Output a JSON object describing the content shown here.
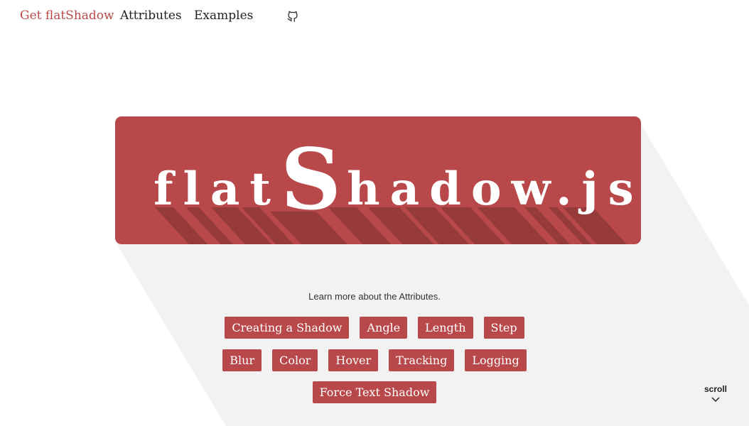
{
  "nav": {
    "items": [
      {
        "label": "Get flatShadow",
        "active": true
      },
      {
        "label": "Attributes",
        "active": false
      },
      {
        "label": "Examples",
        "active": false
      }
    ],
    "github_icon": "github-icon"
  },
  "hero": {
    "prefix": "flat",
    "big_letter": "S",
    "suffix": "hadow.js",
    "color": "#b84849",
    "shadow_color": "#963a3b",
    "page_shadow_color": "#f2f2f2"
  },
  "attributes": {
    "intro": "Learn more about the Attributes.",
    "rows": [
      [
        "Creating a Shadow",
        "Angle",
        "Length",
        "Step"
      ],
      [
        "Blur",
        "Color",
        "Hover",
        "Tracking",
        "Logging"
      ],
      [
        "Force Text Shadow"
      ]
    ]
  },
  "scroll": {
    "label": "scroll",
    "icon": "chevron-down-icon"
  }
}
